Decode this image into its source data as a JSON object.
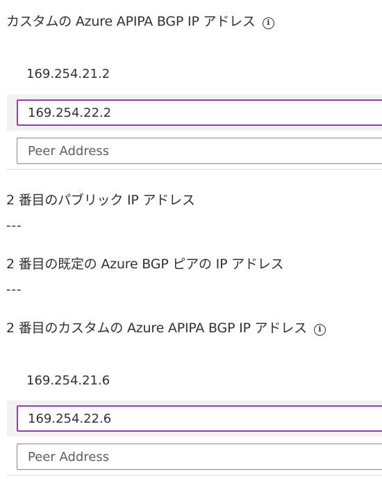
{
  "section1": {
    "label": "カスタムの Azure APIPA BGP IP アドレス",
    "info_icon": "info-icon",
    "primary_value": "169.254.21.2",
    "input_value": "169.254.22.2",
    "peer_placeholder": "Peer Address"
  },
  "secondary_public_ip": {
    "label": "2 番目のパブリック IP アドレス",
    "value": "---"
  },
  "secondary_default_bgp": {
    "label": "2 番目の既定の Azure BGP ピアの IP アドレス",
    "value": "---"
  },
  "section2": {
    "label": "2 番目のカスタムの Azure APIPA BGP IP アドレス",
    "info_icon": "info-icon",
    "primary_value": "169.254.21.6",
    "input_value": "169.254.22.6",
    "peer_placeholder": "Peer Address"
  },
  "colors": {
    "focus_border": "#8a3fae",
    "selected_band": "#f3f2f1",
    "text": "#323130",
    "placeholder": "#605e5c"
  }
}
